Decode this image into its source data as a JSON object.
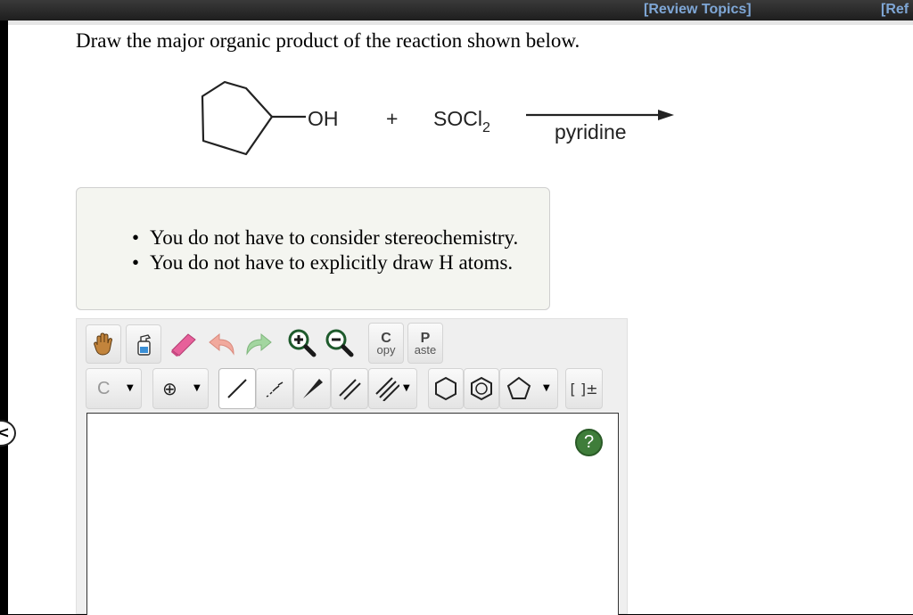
{
  "topbar": {
    "review_topics": "[Review Topics]",
    "references": "[Ref"
  },
  "question": {
    "prompt": "Draw the major organic product of the reaction shown below.",
    "reaction": {
      "reactant_substituent": "OH",
      "plus": "+",
      "reagent_main": "SOCl",
      "reagent_subscript": "2",
      "condition": "pyridine"
    },
    "notes": [
      "You do not have to consider stereochemistry.",
      "You do not have to explicitly draw H atoms."
    ]
  },
  "editor": {
    "copy_big": "C",
    "copy_small": "opy",
    "paste_big": "P",
    "paste_small": "aste",
    "element_button": "C",
    "charge_symbol": "⊕",
    "bracket_label": "[ ]±",
    "help_label": "?",
    "dropdown_glyph": "▼"
  },
  "nav": {
    "collapse_glyph": "<"
  },
  "colors": {
    "link": "#7fa7d6",
    "help_green": "#3f7d3a",
    "note_bg": "#f4f5f0"
  }
}
